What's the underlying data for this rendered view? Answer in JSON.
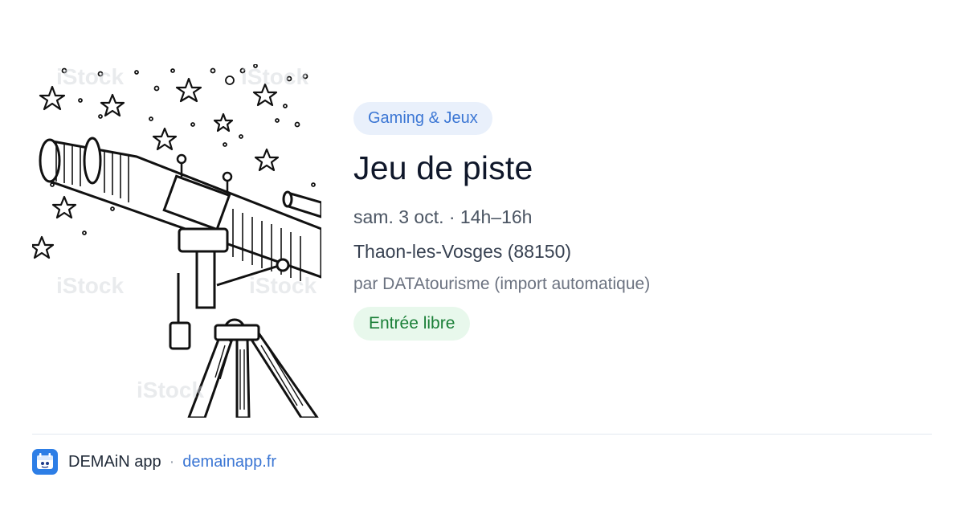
{
  "event": {
    "category": "Gaming & Jeux",
    "title": "Jeu de piste",
    "datetime": "sam. 3 oct. · 14h–16h",
    "location": "Thaon-les-Vosges (88150)",
    "organizer": "par DATAtourisme (import automatique)",
    "price": "Entrée libre",
    "image": {
      "icon": "telescope-illustration",
      "watermark": "iStock by Getty Images"
    }
  },
  "footer": {
    "app_icon": "demain-app-icon",
    "app_name": "DEMAiN app",
    "separator": "·",
    "link": "demainapp.fr"
  },
  "colors": {
    "accent": "#3b76d4",
    "category_bg": "#e9f0fb",
    "price_bg": "#e8f8ec",
    "price_text": "#1a7f37",
    "app_icon_bg": "#2d7ee6"
  }
}
